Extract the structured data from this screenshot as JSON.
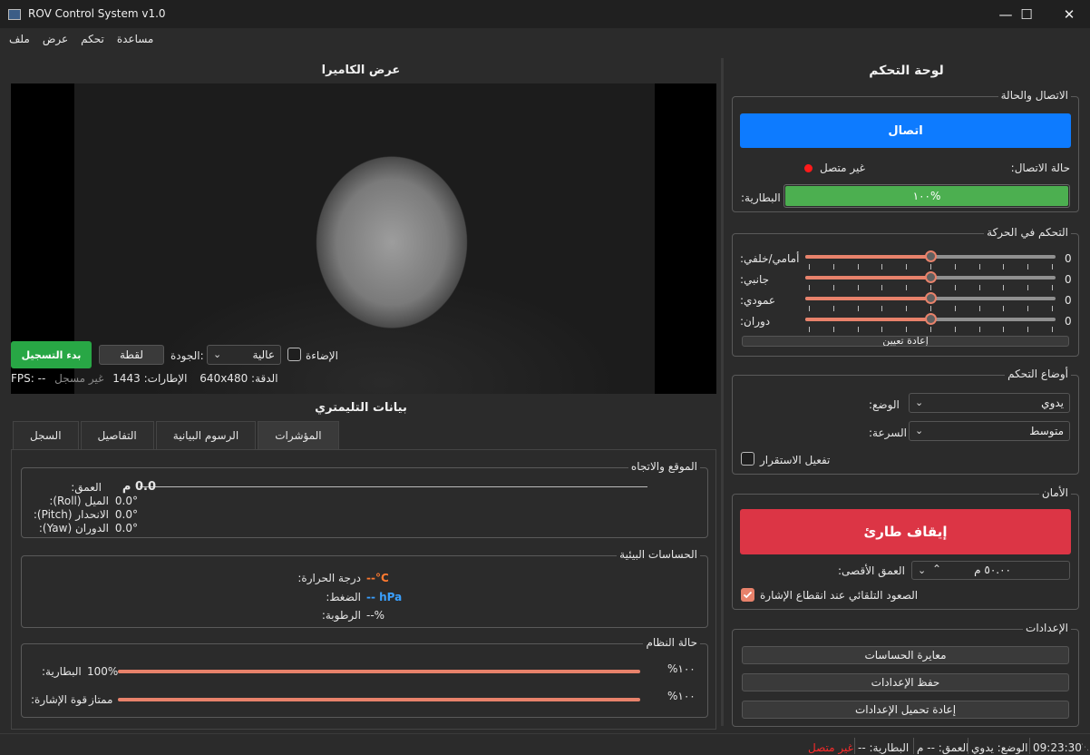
{
  "window": {
    "title": "ROV Control System v1.0",
    "minimize": "—",
    "maximize": "☐",
    "close": "✕"
  },
  "menu": [
    "ملف",
    "عرض",
    "تحكم",
    "مساعدة"
  ],
  "camera": {
    "heading": "عرض الكاميرا",
    "record_label": "بدء التسجيل",
    "snapshot_label": "لقطة",
    "quality_label": "الجودة:",
    "quality_value": "عالية",
    "light_label": "الإضاءة",
    "light_on": false,
    "fps": "FPS: --",
    "resolution": "الدقة: 640x480",
    "frames": "الإطارات: 1443",
    "rec_status": "غير مسجل"
  },
  "telemetry": {
    "heading": "بيانات التليمتري",
    "tabs": [
      "المؤشرات",
      "الرسوم البيانية",
      "التفاصيل",
      "السجل"
    ],
    "position": {
      "title": "الموقع والاتجاه",
      "depth_label": "العمق:",
      "depth_value": "0.0",
      "depth_unit": "م",
      "roll_label": "الميل (Roll):",
      "roll_value": "0.0°",
      "pitch_label": "الانحدار (Pitch):",
      "pitch_value": "0.0°",
      "yaw_label": "الدوران (Yaw):",
      "yaw_value": "0.0°"
    },
    "env": {
      "title": "الحساسات البيئية",
      "temp_label": "درجة الحرارة:",
      "temp_value": "--°C",
      "pressure_label": "الضغط:",
      "pressure_value": "-- hPa",
      "humidity_label": "الرطوبة:",
      "humidity_value": "--%"
    },
    "system": {
      "title": "حالة النظام",
      "battery_label": "البطارية:",
      "battery_value": "100%",
      "battery_bar": "١٠٠%",
      "battery_fraction": 1.0,
      "signal_label": "قوة الإشارة:",
      "signal_value": "ممتاز",
      "signal_bar": "١٠٠%",
      "signal_fraction": 1.0
    }
  },
  "control": {
    "heading": "لوحة التحكم",
    "connection": {
      "title": "الاتصال والحالة",
      "connect_label": "اتصال",
      "status_label": "حالة الاتصال:",
      "status_value": "غير متصل",
      "battery_label": "البطارية:",
      "battery_text": "١٠٠%",
      "battery_fraction": 1.0
    },
    "motion": {
      "title": "التحكم في الحركة",
      "sliders": [
        {
          "label": "أمامي/خلفي:",
          "value": "0"
        },
        {
          "label": "جانبي:",
          "value": "0"
        },
        {
          "label": "عمودي:",
          "value": "0"
        },
        {
          "label": "دوران:",
          "value": "0"
        }
      ],
      "reset_label": "إعادة تعيين"
    },
    "modes": {
      "title": "أوضاع التحكم",
      "mode_label": "الوضع:",
      "mode_value": "يدوي",
      "speed_label": "السرعة:",
      "speed_value": "متوسط",
      "stabilize_label": "تفعيل الاستقرار",
      "stabilize_on": false
    },
    "safety": {
      "title": "الأمان",
      "estop_label": "إيقاف طارئ",
      "maxdepth_label": "العمق الأقصى:",
      "maxdepth_value": "٥٠.٠٠ م",
      "autosurface_label": "الصعود التلقائي عند انقطاع الإشارة",
      "autosurface_on": true
    },
    "settings": {
      "title": "الإعدادات",
      "calibrate_label": "معايرة الحساسات",
      "save_label": "حفظ الإعدادات",
      "reload_label": "إعادة تحميل الإعدادات"
    }
  },
  "statusbar": {
    "time": "09:23:30",
    "mode": "الوضع: يدوي",
    "depth": "العمق: -- م",
    "battery": "البطارية: --",
    "connection": "غير متصل"
  },
  "colors": {
    "accent": "#e8826b",
    "connect": "#0d7bff",
    "estop": "#dc3545",
    "record": "#28a745",
    "battery": "#4caf50",
    "offline": "#ff2a2a"
  }
}
